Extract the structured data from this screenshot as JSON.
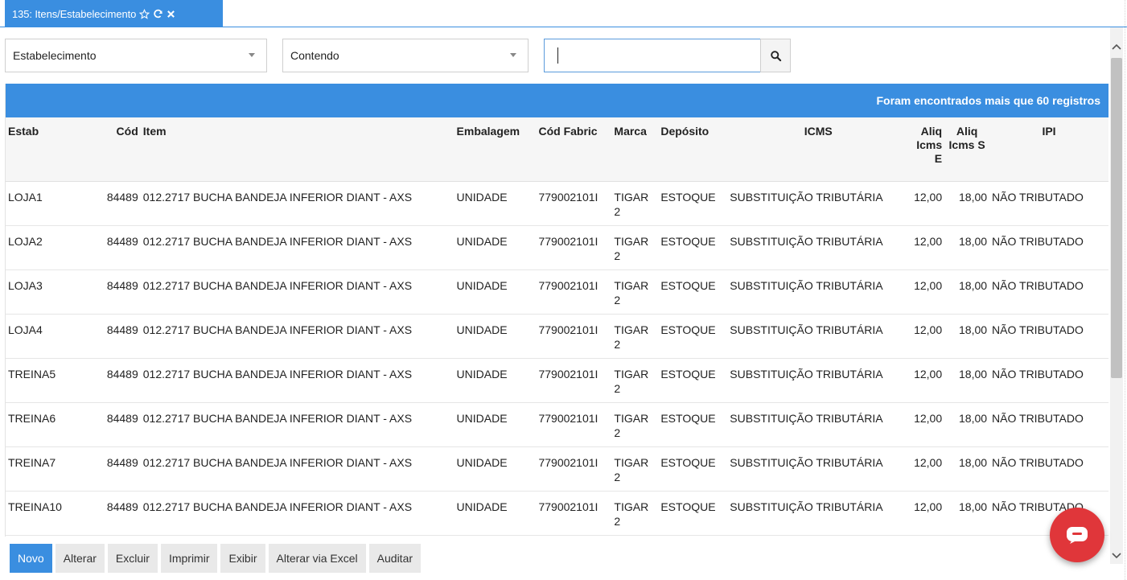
{
  "tab": {
    "label": "135: Itens/Estabelecimento"
  },
  "filters": {
    "field_select": "Estabelecimento",
    "operator_select": "Contendo",
    "search_value": ""
  },
  "grid": {
    "banner": "Foram encontrados mais que 60 registros",
    "columns": {
      "estab": "Estab",
      "cod": "Cód",
      "item": "Item",
      "embalagem": "Embalagem",
      "cod_fabric": "Cód Fabric",
      "marca": "Marca",
      "deposito": "Depósito",
      "icms": "ICMS",
      "aliq_e": "Aliq Icms E",
      "aliq_s": "Aliq Icms S",
      "ipi": "IPI"
    },
    "rows": [
      {
        "estab": "LOJA1",
        "cod": "84489",
        "item": "012.2717 BUCHA BANDEJA INFERIOR DIANT - AXS",
        "embalagem": "UNIDADE",
        "cod_fabric": "779002101I",
        "marca": "TIGAR 2",
        "deposito": "ESTOQUE",
        "icms": "SUBSTITUIÇÃO TRIBUTÁRIA",
        "aliq_e": "12,00",
        "aliq_s": "18,00",
        "ipi": "NÃO TRIBUTADO"
      },
      {
        "estab": "LOJA2",
        "cod": "84489",
        "item": "012.2717 BUCHA BANDEJA INFERIOR DIANT - AXS",
        "embalagem": "UNIDADE",
        "cod_fabric": "779002101I",
        "marca": "TIGAR 2",
        "deposito": "ESTOQUE",
        "icms": "SUBSTITUIÇÃO TRIBUTÁRIA",
        "aliq_e": "12,00",
        "aliq_s": "18,00",
        "ipi": "NÃO TRIBUTADO"
      },
      {
        "estab": "LOJA3",
        "cod": "84489",
        "item": "012.2717 BUCHA BANDEJA INFERIOR DIANT - AXS",
        "embalagem": "UNIDADE",
        "cod_fabric": "779002101I",
        "marca": "TIGAR 2",
        "deposito": "ESTOQUE",
        "icms": "SUBSTITUIÇÃO TRIBUTÁRIA",
        "aliq_e": "12,00",
        "aliq_s": "18,00",
        "ipi": "NÃO TRIBUTADO"
      },
      {
        "estab": "LOJA4",
        "cod": "84489",
        "item": "012.2717 BUCHA BANDEJA INFERIOR DIANT - AXS",
        "embalagem": "UNIDADE",
        "cod_fabric": "779002101I",
        "marca": "TIGAR 2",
        "deposito": "ESTOQUE",
        "icms": "SUBSTITUIÇÃO TRIBUTÁRIA",
        "aliq_e": "12,00",
        "aliq_s": "18,00",
        "ipi": "NÃO TRIBUTADO"
      },
      {
        "estab": "TREINA5",
        "cod": "84489",
        "item": "012.2717 BUCHA BANDEJA INFERIOR DIANT - AXS",
        "embalagem": "UNIDADE",
        "cod_fabric": "779002101I",
        "marca": "TIGAR 2",
        "deposito": "ESTOQUE",
        "icms": "SUBSTITUIÇÃO TRIBUTÁRIA",
        "aliq_e": "12,00",
        "aliq_s": "18,00",
        "ipi": "NÃO TRIBUTADO"
      },
      {
        "estab": "TREINA6",
        "cod": "84489",
        "item": "012.2717 BUCHA BANDEJA INFERIOR DIANT - AXS",
        "embalagem": "UNIDADE",
        "cod_fabric": "779002101I",
        "marca": "TIGAR 2",
        "deposito": "ESTOQUE",
        "icms": "SUBSTITUIÇÃO TRIBUTÁRIA",
        "aliq_e": "12,00",
        "aliq_s": "18,00",
        "ipi": "NÃO TRIBUTADO"
      },
      {
        "estab": "TREINA7",
        "cod": "84489",
        "item": "012.2717 BUCHA BANDEJA INFERIOR DIANT - AXS",
        "embalagem": "UNIDADE",
        "cod_fabric": "779002101I",
        "marca": "TIGAR 2",
        "deposito": "ESTOQUE",
        "icms": "SUBSTITUIÇÃO TRIBUTÁRIA",
        "aliq_e": "12,00",
        "aliq_s": "18,00",
        "ipi": "NÃO TRIBUTADO"
      },
      {
        "estab": "TREINA10",
        "cod": "84489",
        "item": "012.2717 BUCHA BANDEJA INFERIOR DIANT - AXS",
        "embalagem": "UNIDADE",
        "cod_fabric": "779002101I",
        "marca": "TIGAR 2",
        "deposito": "ESTOQUE",
        "icms": "SUBSTITUIÇÃO TRIBUTÁRIA",
        "aliq_e": "12,00",
        "aliq_s": "18,00",
        "ipi": "NÃO TRIBUTADO"
      }
    ]
  },
  "toolbar": {
    "novo": "Novo",
    "alterar": "Alterar",
    "excluir": "Excluir",
    "imprimir": "Imprimir",
    "exibir": "Exibir",
    "alterar_excel": "Alterar via Excel",
    "auditar": "Auditar"
  },
  "colors": {
    "accent": "#3a8ee0",
    "fab": "#e0363a"
  },
  "icons": [
    "star-icon",
    "refresh-icon",
    "close-icon",
    "chevron-down-icon",
    "search-icon",
    "chat-icon",
    "chevron-up-icon"
  ]
}
